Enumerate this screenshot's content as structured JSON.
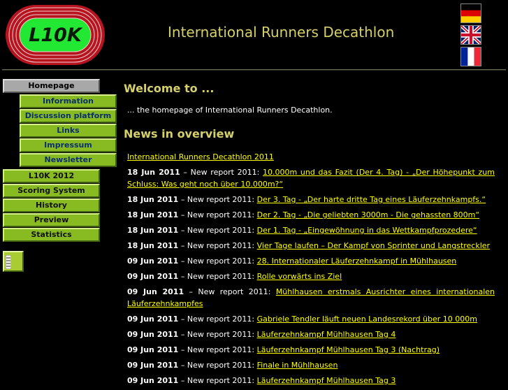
{
  "header": {
    "logo_text": "L10K",
    "title": "International Runners Decathlon",
    "languages": [
      "german-flag",
      "english-flag",
      "french-flag"
    ]
  },
  "colors": {
    "background": "#000000",
    "heading": "#d6d06a",
    "link": "#ffff00",
    "nav_green": "#88bb22",
    "nav_active": "#a8a8a8",
    "logo_track": "#b81420",
    "logo_inner": "#22e834"
  },
  "nav": {
    "homepage": "Homepage",
    "sub_items": [
      "Information",
      "Discussion platform",
      "Links",
      "Impressum",
      "Newsletter"
    ],
    "top_items": [
      "L10K 2012",
      "Scoring System",
      "History",
      "Preview",
      "Statistics"
    ],
    "util_icon": "counter-icon"
  },
  "main": {
    "welcome_heading": "Welcome to ...",
    "intro": "... the homepage of International Runners Decathlon.",
    "news_heading": "News in overview",
    "first_link": "International Runners Decathlon 2011",
    "news_prefix": "New report 2011:",
    "news": [
      {
        "date": "18 Jun 2011",
        "link": "10.000m und das Fazit (Der 4. Tag) - „Der Höhepunkt zum Schluss: Was geht noch über 10.000m?“"
      },
      {
        "date": "18 Jun 2011",
        "link": "Der 3. Tag - „Der harte dritte Tag eines Läuferzehnkampfs.“"
      },
      {
        "date": "18 Jun 2011",
        "link": "Der 2. Tag - „Die geliebten 3000m - Die gehassten 800m“"
      },
      {
        "date": "18 Jun 2011",
        "link": "Der 1. Tag - „Eingewöhnung in das Wettkampfprozedere“"
      },
      {
        "date": "18 Jun 2011",
        "link": "Vier Tage laufen – Der Kampf von Sprinter und Langstreckler"
      },
      {
        "date": "09 Jun 2011",
        "link": "28. Internationaler Läuferzehnkampf in Mühlhausen"
      },
      {
        "date": "09 Jun 2011",
        "link": "Rolle vorwärts ins Ziel"
      },
      {
        "date": "09 Jun 2011",
        "link": "Mühlhausen erstmals Ausrichter eines internationalen Läuferzehnkampfes"
      },
      {
        "date": "09 Jun 2011",
        "link": "Gabriele Tendler läuft neuen Landesrekord über 10 000m"
      },
      {
        "date": "09 Jun 2011",
        "link": "Läuferzehnkampf Mühlhausen Tag 4"
      },
      {
        "date": "09 Jun 2011",
        "link": "Läuferzehnkampf Mühlhausen Tag 3 (Nachtrag)"
      },
      {
        "date": "09 Jun 2011",
        "link": "Finale in Mühlhausen"
      },
      {
        "date": "09 Jun 2011",
        "link": "Läuferzehnkampf Mühlhausen Tag 3"
      }
    ]
  }
}
